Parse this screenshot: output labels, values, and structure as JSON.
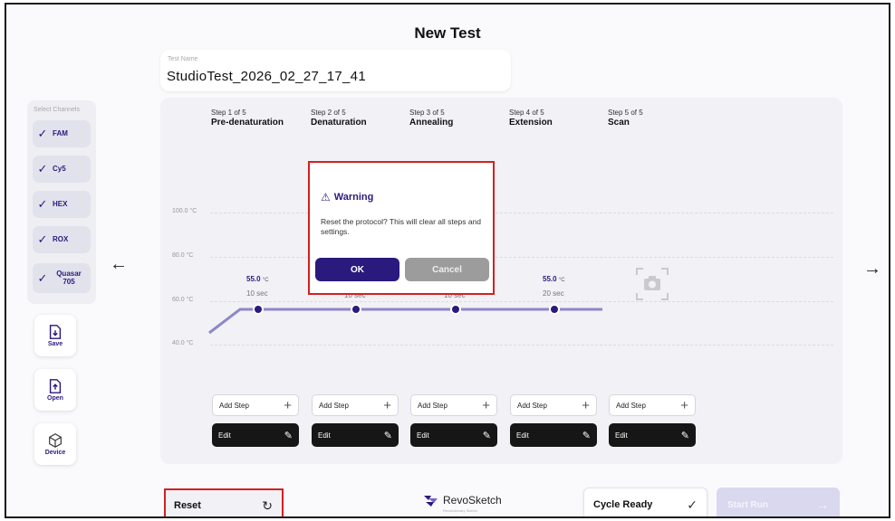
{
  "header": {
    "title": "New Test"
  },
  "test_name": {
    "label": "Test Name",
    "value": "StudioTest_2026_02_27_17_41"
  },
  "channels": {
    "label": "Select Channels",
    "items": [
      {
        "check": "✓",
        "name": "FAM"
      },
      {
        "check": "✓",
        "name": "Cy5"
      },
      {
        "check": "✓",
        "name": "HEX"
      },
      {
        "check": "✓",
        "name": "ROX"
      },
      {
        "check": "✓",
        "name": "Quasar 705"
      }
    ]
  },
  "side_buttons": {
    "save": "Save",
    "open": "Open",
    "device": "Device"
  },
  "nav": {
    "prev": "←",
    "next": "→"
  },
  "steps": [
    {
      "index": "Step 1 of 5",
      "name": "Pre-denaturation",
      "temp": "55.0",
      "unit": "°C",
      "duration": "10 sec"
    },
    {
      "index": "Step 2 of 5",
      "name": "Denaturation",
      "temp": "",
      "unit": "",
      "duration": "10 sec"
    },
    {
      "index": "Step 3 of 5",
      "name": "Annealing",
      "temp": "",
      "unit": "",
      "duration": "10 sec"
    },
    {
      "index": "Step 4 of 5",
      "name": "Extension",
      "temp": "55.0",
      "unit": "°C",
      "duration": "20 sec"
    },
    {
      "index": "Step 5 of 5",
      "name": "Scan",
      "temp": "",
      "unit": "",
      "duration": ""
    }
  ],
  "y_axis": [
    "100.0 °C",
    "80.0 °C",
    "60.0 °C",
    "40.0 °C"
  ],
  "step_actions": {
    "add_step": "Add Step",
    "add_icon": "+",
    "edit": "Edit",
    "edit_icon": "✎"
  },
  "dialog": {
    "icon": "⚠",
    "title": "Warning",
    "message": "Reset the protocol? This will clear all steps and settings.",
    "ok": "OK",
    "cancel": "Cancel"
  },
  "footer": {
    "reset": "Reset",
    "reset_icon": "↻",
    "logo": "RevoSketch",
    "logo_sub": "Revolutionary Sketch",
    "cycle_ready": "Cycle Ready",
    "cycle_icon": "✓",
    "start_run": "Start Run",
    "start_icon": "→"
  },
  "colors": {
    "accent": "#2a1a7e",
    "highlight": "#d42020",
    "line": "#8e87c9"
  }
}
